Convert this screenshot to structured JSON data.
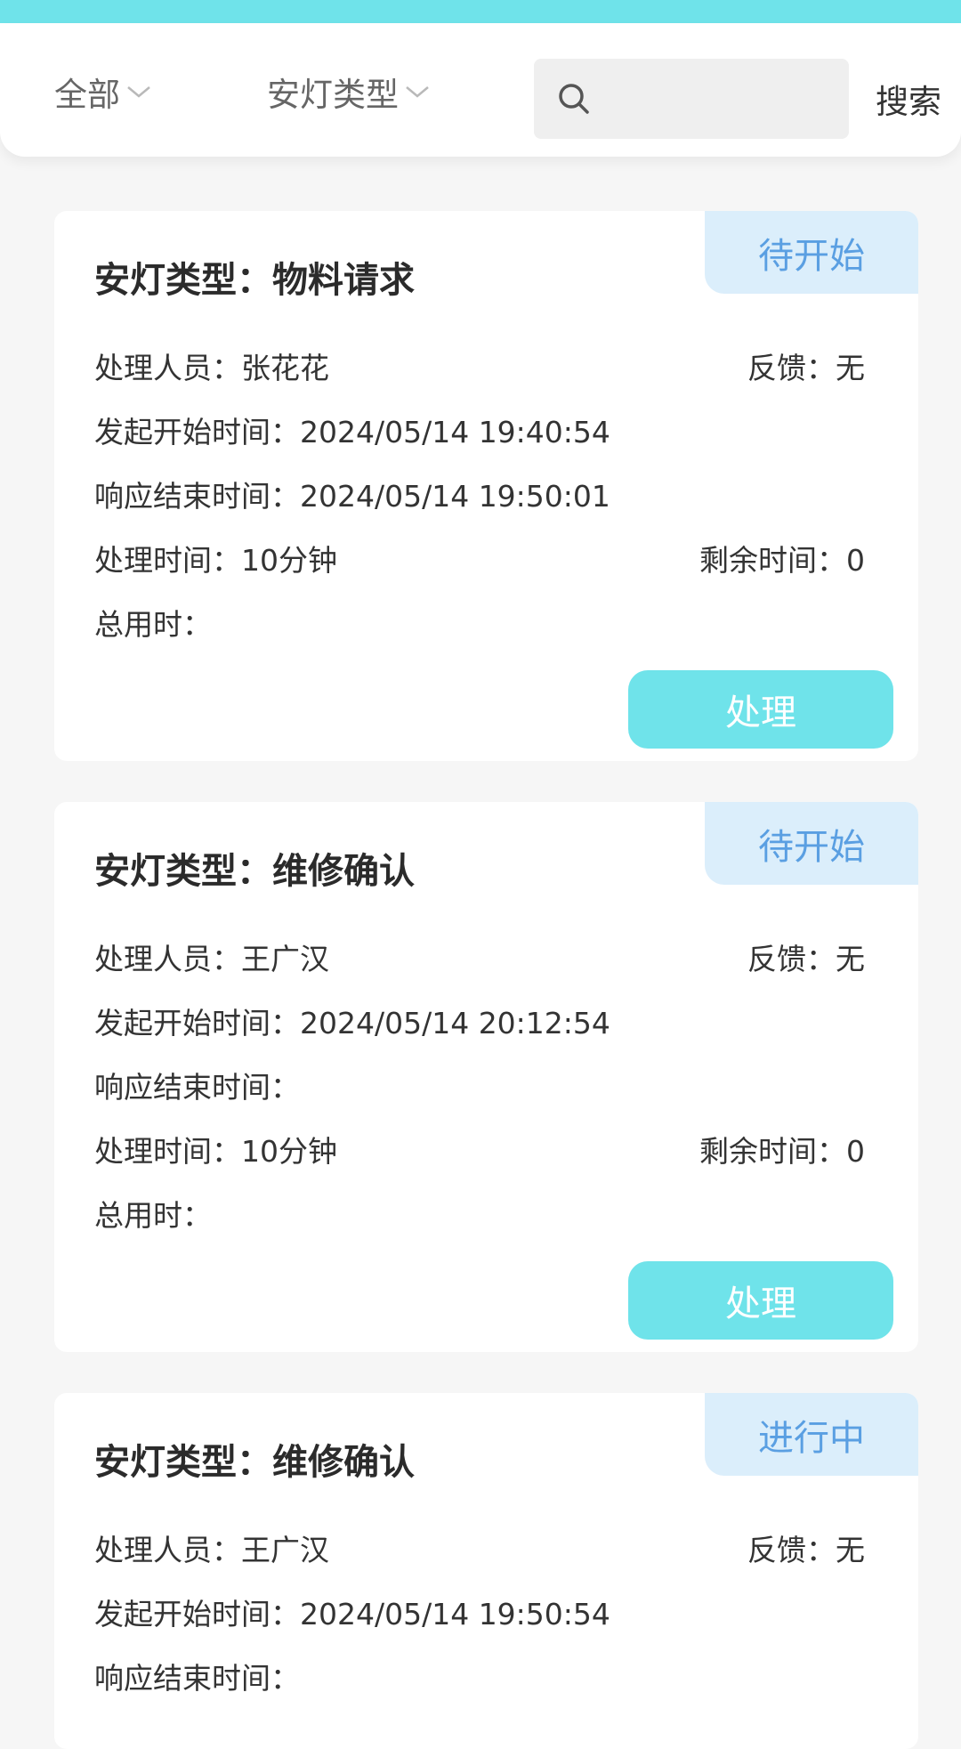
{
  "filter": {
    "status_dropdown": "全部",
    "type_dropdown": "安灯类型",
    "search_placeholder": "",
    "search_button": "搜索"
  },
  "labels": {
    "type_prefix": "安灯类型：",
    "handler": "处理人员：",
    "feedback": "反馈：",
    "start_time": "发起开始时间：",
    "end_time": "响应结束时间：",
    "process_time": "处理时间：",
    "remaining": "剩余时间：",
    "total": "总用时：",
    "process_button": "处理"
  },
  "cards": [
    {
      "type": "物料请求",
      "status": "待开始",
      "handler": "张花花",
      "feedback": "无",
      "start_time": "2024/05/14 19:40:54",
      "end_time": "2024/05/14 19:50:01",
      "process_time": "10分钟",
      "remaining": "0",
      "total": ""
    },
    {
      "type": "维修确认",
      "status": "待开始",
      "handler": "王广汉",
      "feedback": "无",
      "start_time": "2024/05/14 20:12:54",
      "end_time": "",
      "process_time": "10分钟",
      "remaining": "0",
      "total": ""
    },
    {
      "type": "维修确认",
      "status": "进行中",
      "handler": "王广汉",
      "feedback": "无",
      "start_time": "2024/05/14 19:50:54",
      "end_time": ""
    }
  ],
  "colors": {
    "accent": "#6fe3ea",
    "status_bg": "#dbeefb",
    "status_text": "#5a9fe2",
    "page_bg": "#f6f6f6"
  },
  "icons": {
    "search": "search-icon",
    "chevron": "chevron-down-icon"
  }
}
